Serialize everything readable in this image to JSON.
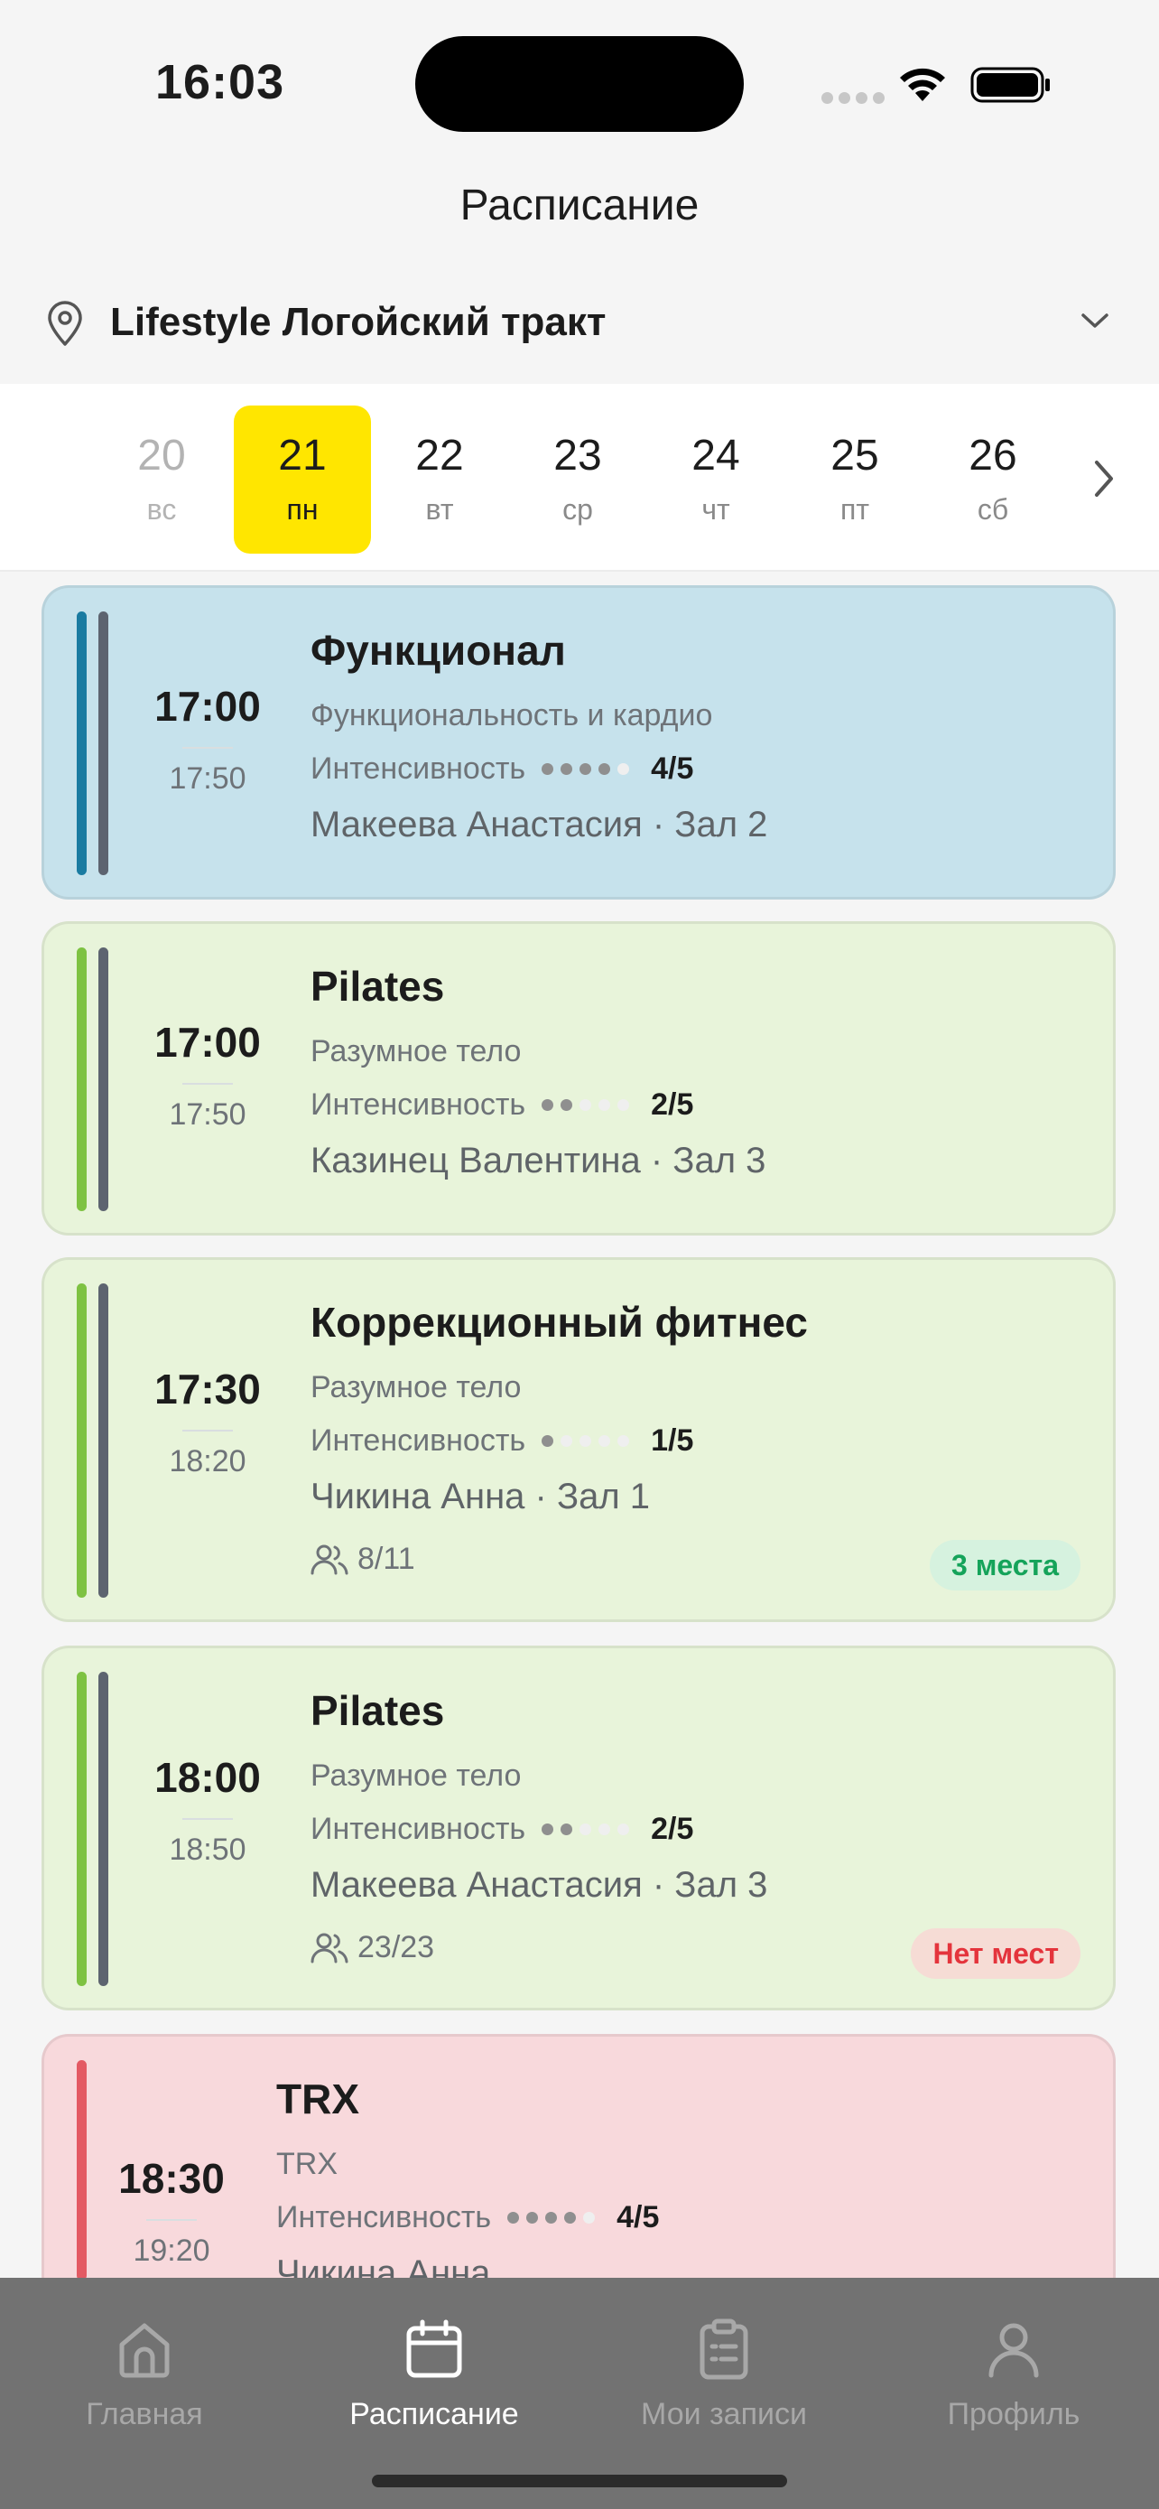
{
  "status_bar": {
    "time": "16:03"
  },
  "header": {
    "title": "Расписание",
    "location": "Lifestyle Логойский тракт"
  },
  "days": [
    {
      "num": "20",
      "dow": "вс",
      "state": "past"
    },
    {
      "num": "21",
      "dow": "пн",
      "state": "active"
    },
    {
      "num": "22",
      "dow": "вт",
      "state": "normal"
    },
    {
      "num": "23",
      "dow": "ср",
      "state": "normal"
    },
    {
      "num": "24",
      "dow": "чт",
      "state": "normal"
    },
    {
      "num": "25",
      "dow": "пт",
      "state": "normal"
    },
    {
      "num": "26",
      "dow": "сб",
      "state": "normal"
    }
  ],
  "intensity_label": "Интенсивность",
  "classes": [
    {
      "title": "Функционал",
      "subtitle": "Функциональность и кардио",
      "start": "17:00",
      "end": "17:50",
      "intensity": 4,
      "score": "4/5",
      "trainer": "Макеева Анастасия · Зал 2",
      "color": "#c6e2ec",
      "bar1": "#1a7ba1",
      "bar2": "#5d6470"
    },
    {
      "title": "Pilates",
      "subtitle": "Разумное тело",
      "start": "17:00",
      "end": "17:50",
      "intensity": 2,
      "score": "2/5",
      "trainer": "Казинец Валентина · Зал 3",
      "color": "#e8f4da",
      "bar1": "#7ec242",
      "bar2": "#5d6470"
    },
    {
      "title": "Коррекционный фитнес",
      "subtitle": "Разумное тело",
      "start": "17:30",
      "end": "18:20",
      "intensity": 1,
      "score": "1/5",
      "trainer": "Чикина Анна · Зал 1",
      "capacity": "8/11",
      "badge": "3 места",
      "color": "#e8f4da",
      "bar1": "#7ec242",
      "bar2": "#5d6470"
    },
    {
      "title": "Pilates",
      "subtitle": "Разумное тело",
      "start": "18:00",
      "end": "18:50",
      "intensity": 2,
      "score": "2/5",
      "trainer": "Макеева Анастасия · Зал 3",
      "capacity": "23/23",
      "badge": "Нет мест",
      "color": "#e8f4da",
      "bar1": "#7ec242",
      "bar2": "#5d6470"
    },
    {
      "title": "TRX",
      "subtitle": "TRX",
      "start": "18:30",
      "end": "19:20",
      "intensity": 4,
      "score": "4/5",
      "trainer": "Чикина Анна",
      "color": "#f8d9dc",
      "bar1": "#e35a63"
    }
  ],
  "tabs": [
    {
      "label": "Главная",
      "icon": "home-icon"
    },
    {
      "label": "Расписание",
      "icon": "calendar-icon",
      "active": true
    },
    {
      "label": "Мои записи",
      "icon": "clipboard-icon"
    },
    {
      "label": "Профиль",
      "icon": "user-icon"
    }
  ]
}
